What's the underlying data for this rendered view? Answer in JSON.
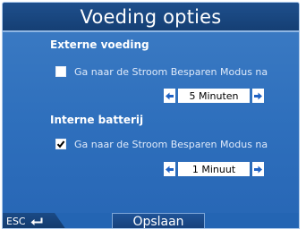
{
  "title": "Voeding opties",
  "external_power": {
    "heading": "Externe voeding",
    "option_label": "Ga naar de Stroom Besparen Modus na",
    "checked": false,
    "spinner_value": "5 Minuten"
  },
  "internal_battery": {
    "heading": "Interne batterij",
    "option_label": "Ga naar de Stroom Besparen Modus na",
    "checked": true,
    "spinner_value": "1 Minuut"
  },
  "footer": {
    "esc_label": "ESC",
    "save_label": "Opslaan"
  },
  "colors": {
    "panel_blue": "#2f70bd",
    "title_bar": "#1e4f8c",
    "arrow_blue": "#1f62c4"
  },
  "icons": {
    "checkmark": "check-icon",
    "left_arrow": "arrow-left-icon",
    "right_arrow": "arrow-right-icon",
    "back": "return-arrow-icon"
  }
}
